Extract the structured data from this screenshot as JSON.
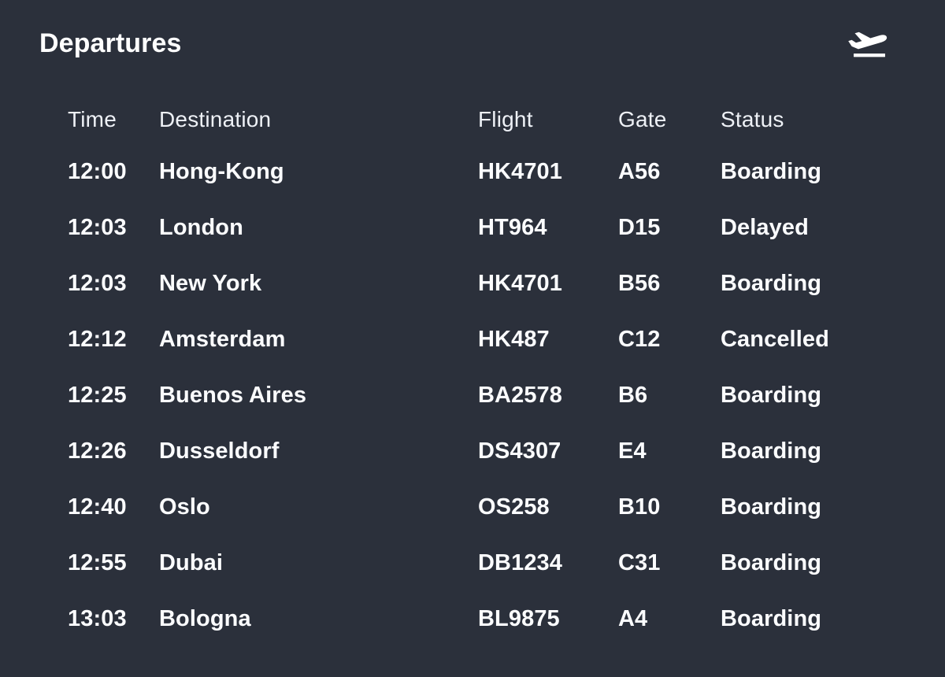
{
  "header": {
    "title": "Departures",
    "icon": "airplane-takeoff-icon"
  },
  "colors": {
    "background": "#2b303b",
    "text": "#f5f7fa",
    "title": "#ffffff",
    "header_text": "#eef1f6"
  },
  "table": {
    "columns": [
      {
        "key": "time",
        "label": "Time"
      },
      {
        "key": "destination",
        "label": "Destination"
      },
      {
        "key": "flight",
        "label": "Flight"
      },
      {
        "key": "gate",
        "label": "Gate"
      },
      {
        "key": "status",
        "label": "Status"
      }
    ],
    "rows": [
      {
        "time": "12:00",
        "destination": "Hong-Kong",
        "flight": "HK4701",
        "gate": "A56",
        "status": "Boarding"
      },
      {
        "time": "12:03",
        "destination": "London",
        "flight": "HT964",
        "gate": "D15",
        "status": "Delayed"
      },
      {
        "time": "12:03",
        "destination": "New York",
        "flight": "HK4701",
        "gate": "B56",
        "status": "Boarding"
      },
      {
        "time": "12:12",
        "destination": "Amsterdam",
        "flight": "HK487",
        "gate": "C12",
        "status": "Cancelled"
      },
      {
        "time": "12:25",
        "destination": "Buenos Aires",
        "flight": "BA2578",
        "gate": "B6",
        "status": "Boarding"
      },
      {
        "time": "12:26",
        "destination": "Dusseldorf",
        "flight": "DS4307",
        "gate": "E4",
        "status": "Boarding"
      },
      {
        "time": "12:40",
        "destination": "Oslo",
        "flight": "OS258",
        "gate": "B10",
        "status": "Boarding"
      },
      {
        "time": "12:55",
        "destination": "Dubai",
        "flight": "DB1234",
        "gate": "C31",
        "status": "Boarding"
      },
      {
        "time": "13:03",
        "destination": "Bologna",
        "flight": "BL9875",
        "gate": "A4",
        "status": "Boarding"
      }
    ]
  }
}
